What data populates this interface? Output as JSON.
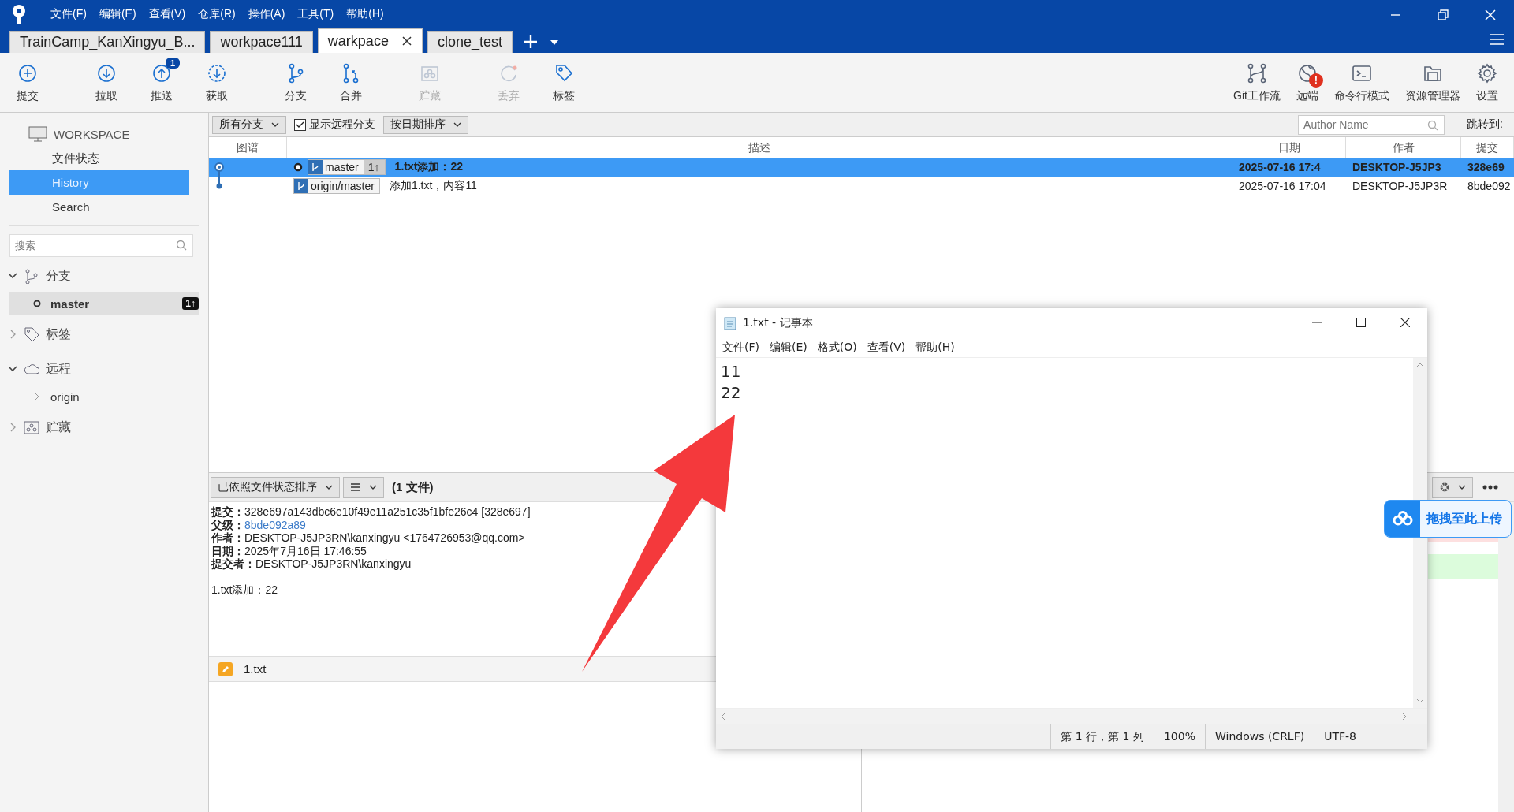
{
  "menu": [
    "文件(F)",
    "编辑(E)",
    "查看(V)",
    "仓库(R)",
    "操作(A)",
    "工具(T)",
    "帮助(H)"
  ],
  "tabs": [
    {
      "label": "TrainCamp_KanXingyu_B...",
      "selected": false
    },
    {
      "label": "workpace111",
      "selected": false
    },
    {
      "label": "warkpace",
      "selected": true
    },
    {
      "label": "clone_test",
      "selected": false
    }
  ],
  "toolbar_left": [
    {
      "kind": "commit",
      "label": "提交",
      "disabled": false
    },
    {
      "kind": "pull",
      "label": "拉取",
      "disabled": false
    },
    {
      "kind": "push",
      "label": "推送",
      "disabled": false,
      "badge": "1"
    },
    {
      "kind": "fetch",
      "label": "获取",
      "disabled": false
    },
    {
      "kind": "branch",
      "label": "分支",
      "disabled": false
    },
    {
      "kind": "merge",
      "label": "合并",
      "disabled": false
    },
    {
      "kind": "stash",
      "label": "贮藏",
      "disabled": true
    },
    {
      "kind": "discard",
      "label": "丢弃",
      "disabled": true
    },
    {
      "kind": "tag",
      "label": "标签",
      "disabled": false
    }
  ],
  "toolbar_right": [
    {
      "kind": "flow",
      "label": "Git工作流"
    },
    {
      "kind": "remote",
      "label": "远端",
      "badge": "!"
    },
    {
      "kind": "terminal",
      "label": "命令行模式"
    },
    {
      "kind": "explorer",
      "label": "资源管理器"
    },
    {
      "kind": "settings",
      "label": "设置"
    }
  ],
  "sidebar": {
    "workspace": "WORKSPACE",
    "items": [
      {
        "label": "文件状态",
        "selected": false
      },
      {
        "label": "History",
        "selected": true
      },
      {
        "label": "Search",
        "selected": false
      }
    ],
    "search": {
      "placeholder": "搜索"
    },
    "groups": [
      {
        "kind": "branch",
        "label": "分支",
        "expanded": true,
        "children": [
          {
            "label": "master",
            "badge": "1↑",
            "selected": true
          }
        ]
      },
      {
        "kind": "tag",
        "label": "标签",
        "expanded": false
      },
      {
        "kind": "remote",
        "label": "远程",
        "expanded": true,
        "children": [
          {
            "label": "origin",
            "expanded": false
          }
        ]
      },
      {
        "kind": "stash",
        "label": "贮藏",
        "expanded": false
      }
    ]
  },
  "filters": {
    "branches": "所有分支",
    "show_remote": {
      "label": "显示远程分支",
      "checked": true
    },
    "sort": "按日期排序",
    "author": {
      "placeholder": "Author Name"
    },
    "jump": "跳转到:"
  },
  "columns": [
    "图谱",
    "描述",
    "日期",
    "作者",
    "提交"
  ],
  "rows": [
    {
      "selected": true,
      "head": true,
      "refs": [
        {
          "name": "master",
          "ahead": "1↑"
        }
      ],
      "description": "1.txt添加：22",
      "date": "2025-07-16 17:4",
      "author": "DESKTOP-J5JP3",
      "commit": "328e69"
    },
    {
      "selected": false,
      "head": false,
      "refs": [
        {
          "name": "origin/master"
        }
      ],
      "description": "添加1.txt，内容11",
      "date": "2025-07-16 17:04",
      "author": "DESKTOP-J5JP3R",
      "commit": "8bde092"
    }
  ],
  "details": {
    "sort": "已依照文件状态排序",
    "count": "(1 文件)",
    "fields": [
      {
        "label": "提交：",
        "value": "328e697a143dbc6e10f49e11a251c35f1bfe26c4 [328e697]",
        "link": false
      },
      {
        "label": "父级：",
        "value": "8bde092a89",
        "link": true
      },
      {
        "label": "作者：",
        "value": "DESKTOP-J5JP3RN\\kanxingyu <1764726953@qq.com>",
        "link": false
      },
      {
        "label": "日期：",
        "value": "2025年7月16日 17:46:55",
        "link": false
      },
      {
        "label": "提交者：",
        "value": "DESKTOP-J5JP3RN\\kanxingyu",
        "link": false
      }
    ],
    "message": "1.txt添加：22",
    "files": [
      {
        "name": "1.txt"
      }
    ]
  },
  "notepad": {
    "title": "1.txt - 记事本",
    "menu": [
      "文件(F)",
      "编辑(E)",
      "格式(O)",
      "查看(V)",
      "帮助(H)"
    ],
    "lines": [
      "11",
      "22"
    ],
    "status": [
      "第 1 行，第 1 列",
      "100%",
      "Windows (CRLF)",
      "UTF-8"
    ]
  },
  "upload_widget": {
    "label": "拖拽至此上传"
  }
}
